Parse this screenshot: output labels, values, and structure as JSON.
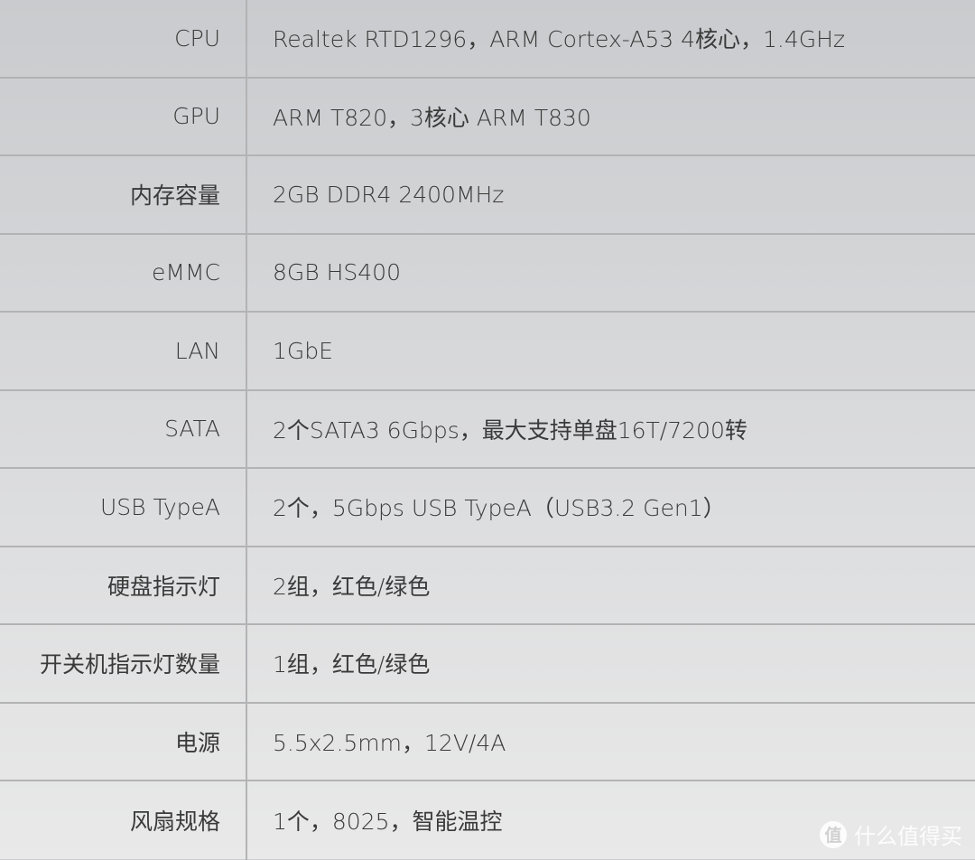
{
  "rows": [
    {
      "label": "CPU",
      "value": "Realtek RTD1296，ARM Cortex-A53 4核心，1.4GHz"
    },
    {
      "label": "GPU",
      "value": "ARM T820，3核心 ARM T830"
    },
    {
      "label": "内存容量",
      "value": "2GB DDR4 2400MHz"
    },
    {
      "label": "eMMC",
      "value": "8GB HS400"
    },
    {
      "label": "LAN",
      "value": "1GbE"
    },
    {
      "label": "SATA",
      "value": "2个SATA3 6Gbps，最大支持单盘16T/7200转"
    },
    {
      "label": "USB TypeA",
      "value": "2个，5Gbps USB TypeA（USB3.2 Gen1）"
    },
    {
      "label": "硬盘指示灯",
      "value": "2组，红色/绿色"
    },
    {
      "label": "开关机指示灯数量",
      "value": "1组，红色/绿色"
    },
    {
      "label": "电源",
      "value": "5.5x2.5mm，12V/4A"
    },
    {
      "label": "风扇规格",
      "value": "1个，8025，智能温控"
    }
  ],
  "watermark": {
    "badge": "值",
    "text": "什么值得买"
  }
}
